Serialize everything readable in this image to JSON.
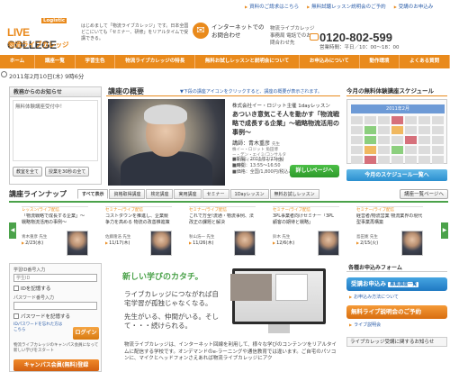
{
  "header": {
    "toplinks": [
      "資料のご請求はこちら",
      "無料試聴レッスン説明会のご予約",
      "受講のお申込み"
    ],
    "logo_badge": "Logistic",
    "logo_live": "LIVE",
    "logo_college": "COLLEGE",
    "logo_jp": "物流ライブカレッジ",
    "tagline": "はじめまして「物流ライブカレッジ」です。日本全国どこにいても「セミナー、研修」をリアルタイムで受講できる。",
    "inquiry": "インターネットでのお問合わせ",
    "center": "物流ライブカレッジ事務局 電話でのお問合わせ先",
    "tel": "0120-802-599",
    "hours": "営業時間：平日／10：00～18：00"
  },
  "nav": [
    "ホーム",
    "講座一覧",
    "学習生色",
    "物流ライブカレッジの特長",
    "無料お試しレッスンと説明会について",
    "お申込みについて",
    "動作環境",
    "よくある質問"
  ],
  "date": "2011年2月10日(木) 9時6分",
  "news": {
    "title": "教務からのお知らせ",
    "body": "無料体験講座受付中！",
    "btn_all": "教室を全て",
    "btn_30": "授業を30秒の全て"
  },
  "overview": {
    "title": "講座の概要",
    "note": "▼下段の講座アイコンをクリックすると、講座の概要が表示されます。",
    "company": "株式会社イー・ロジット主催 1dayレッスン",
    "lecture": "あついき意気こそ人を動かす「物流戦略で成長する企業」～戦略物流活用の事例～",
    "lecturer": "講師：青木重彦",
    "lecturer_suffix": "先生",
    "bio": "株イー・ロジット 角田博 ー・デン・エイミ/コンサルタント/株イー・ロジット 代表取締役",
    "schedule": "■期間：2011年2/23(水)\n■時間：13:55～16:50\n■価格：全国/1,800円/税込み(1日当)",
    "detail_button": "詳しいページへ"
  },
  "calendar": {
    "title": "今月の無料体験講座スケジュール",
    "month": "2011年2月",
    "button": "今月のスケジュール一覧へ"
  },
  "lineup": {
    "title": "講座ラインナップ",
    "tabs": [
      "すべて表示",
      "資格取得講座",
      "検定講座",
      "実用講座",
      "セミナー",
      "1Dayレッスン",
      "無料お試しレッスン"
    ],
    "list_button": "講座一覧ページへ",
    "cards": [
      {
        "cat": "レッスン/ライブ配信",
        "title": "「物流戦略で成長する企業」～戦略物流活用の事例～",
        "who": "青木重彦 先生",
        "date": "2/23(水)"
      },
      {
        "cat": "セミナー/ライブ配信",
        "title": "コストダウンを推進し、企業競争力を高める 物流の改善推進策",
        "who": "佐藤隆浩 先生",
        "date": "11/17(木)"
      },
      {
        "cat": "セミナー/ライブ配信",
        "title": "これで万全!流通・物流事例、法改正の課題と解決",
        "who": "秋山浩一 先生",
        "date": "11/26(木)"
      },
      {
        "cat": "セミナー/ライブ配信",
        "title": "3PL事業者向けセミナー「3PL 顧客の期待と戦略」",
        "who": "鈴木 先生",
        "date": "12/6(木)"
      },
      {
        "cat": "セミナー/ライブ配信",
        "title": "経営者/物流営業 物流業界の現代型事業再構築",
        "who": "島田寛 先生",
        "date": "2/15(火)"
      }
    ]
  },
  "login": {
    "id_label": "学習ID番号入力",
    "id_placeholder": "学生ID",
    "remember_id": "IDを記憶する",
    "pw_label": "パスワード番号入力",
    "remember_pw": "パスワードを記憶する",
    "forgot": "IDパスワードを忘れた方はこちら",
    "login_button": "ログイン",
    "note": "物流ライブカレッジのキャンパス会員になって新しい学びをスタート",
    "register_button": "キャンパス会員(無料)登録"
  },
  "promo": {
    "title": "新しい学びのカタチ。",
    "line1": "ライブカレッジにつながれば自宅学習が孤独じゃなくなる。",
    "line2": "先生がいる、仲間がいる。そして・・・続けられる。",
    "body": "物流ライブカレッジは、インターネット回線を利用して、様々な学びのコンテンツをリアルタイムに配信する学校です。オンデマンドのe-ラーニングや通信教育では違います。ご自宅のパソコンに、マイクとヘッドフォンさえあれば物流ライブカレッジにアク"
  },
  "apply": {
    "title": "各種お申込みフォーム",
    "btn1": "受講お申込み",
    "btn1_sub": "募集講座一覧",
    "link1": "お申込み方法について",
    "btn2": "無料ライブ説明会のご予約",
    "link2": "ライブ説明会",
    "foot": "ライブカレッジ受講に関するお知らせ"
  },
  "colors": {
    "accent": "#e98a1c",
    "green": "#4ba24a",
    "blue": "#2a5ca8"
  }
}
